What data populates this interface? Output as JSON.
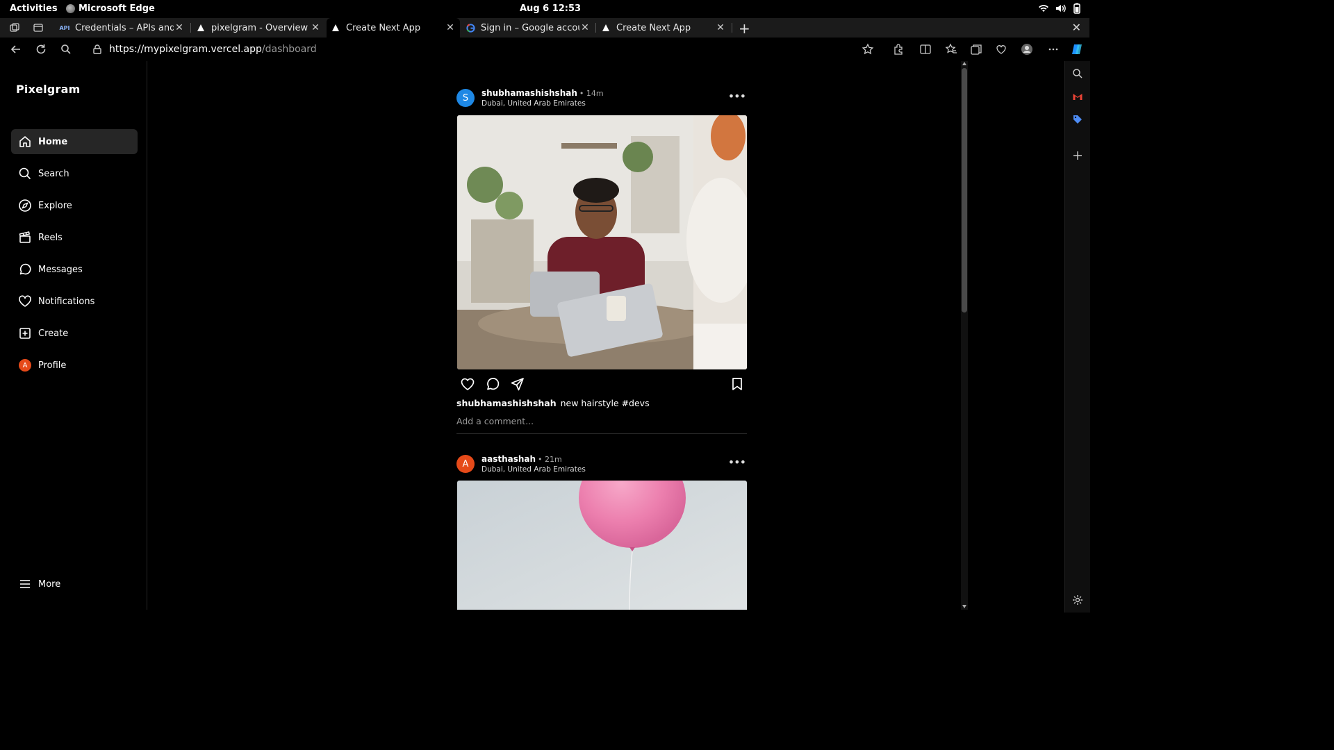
{
  "system": {
    "activities": "Activities",
    "app_name": "Microsoft Edge",
    "clock": "Aug 6  12:53"
  },
  "tabs": [
    {
      "title": "Credentials – APIs and ser",
      "favicon": "api-icon",
      "active": false
    },
    {
      "title": "pixelgram - Overview – Ve",
      "favicon": "vercel-triangle-icon",
      "active": false
    },
    {
      "title": "Create Next App",
      "favicon": "vercel-triangle-icon",
      "active": true
    },
    {
      "title": "Sign in – Google accounts",
      "favicon": "google-icon",
      "active": false
    },
    {
      "title": "Create Next App",
      "favicon": "vercel-triangle-icon",
      "active": false
    }
  ],
  "address": {
    "url_host": "https://mypixelgram.vercel.app",
    "url_path": "/dashboard"
  },
  "app": {
    "logo": "Pixelgram",
    "nav": [
      {
        "label": "Home",
        "icon": "home-icon",
        "active": true
      },
      {
        "label": "Search",
        "icon": "search-icon"
      },
      {
        "label": "Explore",
        "icon": "compass-icon"
      },
      {
        "label": "Reels",
        "icon": "clapperboard-icon"
      },
      {
        "label": "Messages",
        "icon": "message-circle-icon"
      },
      {
        "label": "Notifications",
        "icon": "heart-icon"
      },
      {
        "label": "Create",
        "icon": "plus-square-icon"
      },
      {
        "label": "Profile",
        "icon": "avatar-icon",
        "avatar_letter": "A"
      }
    ],
    "more_label": "More"
  },
  "posts": [
    {
      "avatar_letter": "S",
      "avatar_color": "#1e88e5",
      "username": "shubhamashishshah",
      "time": "• 14m",
      "location": "Dubai, United Arab Emirates",
      "caption_user": "shubhamashishshah",
      "caption_text": "new hairstyle #devs",
      "comment_placeholder": "Add a comment...",
      "image_desc": "office-meeting-photo"
    },
    {
      "avatar_letter": "A",
      "avatar_color": "#e64a19",
      "username": "aasthashah",
      "time": "• 21m",
      "location": "Dubai, United Arab Emirates",
      "image_desc": "pink-balloon-photo"
    }
  ],
  "colors": {
    "background": "#000000",
    "sidebar_active": "#262626",
    "muted_text": "#9a9a9a"
  }
}
